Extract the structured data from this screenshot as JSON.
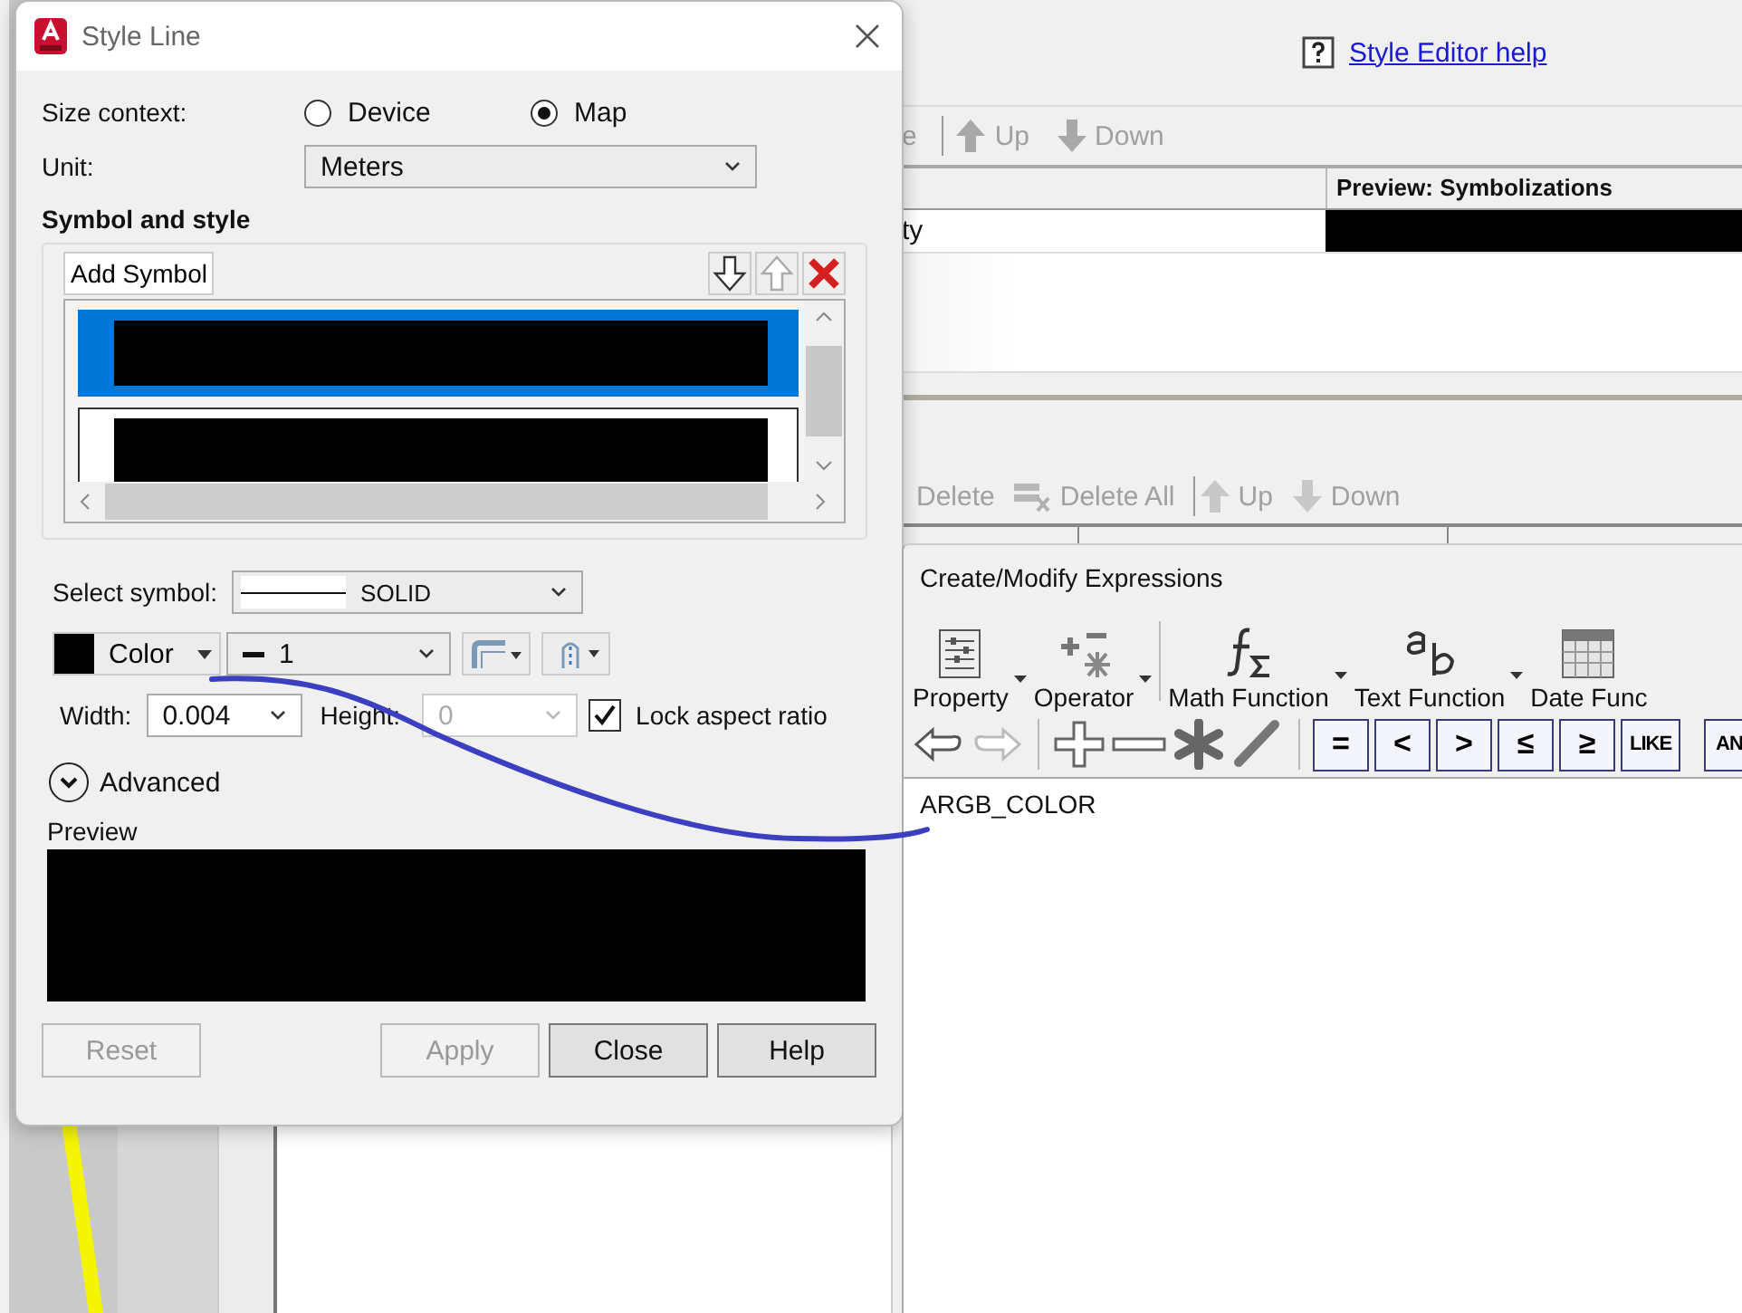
{
  "background_window": {
    "help_link": "Style Editor help",
    "upper_toolbar": [
      {
        "label": "e",
        "kind": "plain"
      },
      {
        "label": "Up",
        "kind": "up"
      },
      {
        "label": "Down",
        "kind": "down"
      }
    ],
    "symbolizations_table": {
      "column_2": "Preview: Symbolizations",
      "rows": [
        {
          "cell_1": "ty"
        }
      ]
    },
    "lower_toolbar": [
      {
        "label": "Delete",
        "kind": "plain"
      },
      {
        "label": "Delete All",
        "kind": "delete_all"
      },
      {
        "label": "Up",
        "kind": "up"
      },
      {
        "label": "Down",
        "kind": "down"
      }
    ]
  },
  "style_line_dialog": {
    "title": "Style Line",
    "size_context_label": "Size context:",
    "size_context_options": [
      {
        "label": "Device",
        "selected": false
      },
      {
        "label": "Map",
        "selected": true
      }
    ],
    "unit_label": "Unit:",
    "unit_value": "Meters",
    "section_title": "Symbol and style",
    "add_symbol_button": "Add Symbol",
    "symbol_list": [
      {
        "selected": true
      },
      {
        "selected": false
      }
    ],
    "select_symbol_label": "Select symbol:",
    "select_symbol_value": "SOLID",
    "color_button": "Color",
    "line_weight": "1",
    "width_label": "Width:",
    "width_value": "0.004",
    "height_label": "Height:",
    "height_value": "0",
    "lock_aspect_ratio": {
      "label": "Lock aspect ratio",
      "checked": true
    },
    "advanced": {
      "label": "Advanced",
      "expanded": false
    },
    "preview_label": "Preview",
    "buttons": [
      {
        "label": "Reset",
        "disabled": true
      },
      {
        "label": "Apply",
        "disabled": true
      },
      {
        "label": "Close",
        "disabled": false
      },
      {
        "label": "Help",
        "disabled": false
      }
    ]
  },
  "expressions_window": {
    "title": "Create/Modify Expressions",
    "tools": [
      {
        "label": "Property",
        "kind": "property"
      },
      {
        "label": "Operator",
        "kind": "operator"
      },
      {
        "label": "Math Function",
        "kind": "math"
      },
      {
        "label": "Text Function",
        "kind": "text"
      },
      {
        "label": "Date Func",
        "kind": "date"
      }
    ],
    "edit_buttons": [
      {
        "kind": "undo"
      },
      {
        "kind": "redo"
      },
      {
        "kind": "plus"
      },
      {
        "kind": "minus"
      },
      {
        "kind": "multiply"
      },
      {
        "kind": "divide"
      }
    ],
    "operators": [
      {
        "label": "="
      },
      {
        "label": "<"
      },
      {
        "label": ">"
      },
      {
        "label": "≤"
      },
      {
        "label": "≥"
      },
      {
        "label": "LIKE"
      },
      {
        "label": "AN"
      }
    ],
    "expression": "ARGB_COLOR"
  }
}
